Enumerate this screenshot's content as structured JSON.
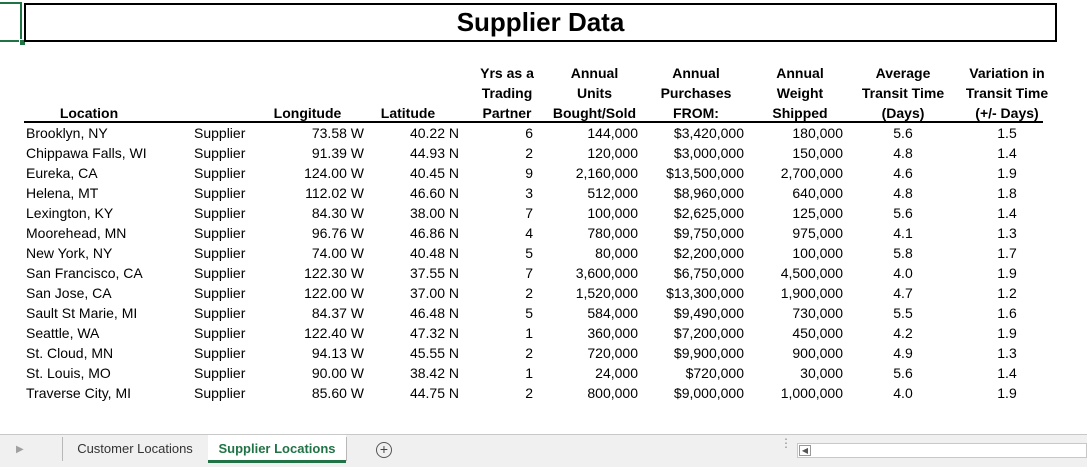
{
  "sheet": {
    "title": "Supplier Data",
    "headers": {
      "location": [
        "Location"
      ],
      "longitude": [
        "Longitude"
      ],
      "latitude": [
        "Latitude"
      ],
      "yrs": [
        "Yrs as a",
        "Trading",
        "Partner"
      ],
      "units": [
        "Annual",
        "Units",
        "Bought/Sold"
      ],
      "purchases": [
        "Annual",
        "Purchases",
        "FROM:"
      ],
      "weight": [
        "Annual",
        "Weight",
        "Shipped"
      ],
      "transit": [
        "Average",
        "Transit Time",
        "(Days)"
      ],
      "variation": [
        "Variation in",
        "Transit Time",
        "(+/- Days)"
      ]
    },
    "rows": [
      {
        "location": "Brooklyn, NY",
        "type": "Supplier",
        "longitude": "73.58 W",
        "latitude": "40.22 N",
        "yrs": "6",
        "units": "144,000",
        "purchases": "$3,420,000",
        "weight": "180,000",
        "transit": "5.6",
        "variation": "1.5"
      },
      {
        "location": "Chippawa Falls, WI",
        "type": "Supplier",
        "longitude": "91.39 W",
        "latitude": "44.93 N",
        "yrs": "2",
        "units": "120,000",
        "purchases": "$3,000,000",
        "weight": "150,000",
        "transit": "4.8",
        "variation": "1.4"
      },
      {
        "location": "Eureka, CA",
        "type": "Supplier",
        "longitude": "124.00 W",
        "latitude": "40.45 N",
        "yrs": "9",
        "units": "2,160,000",
        "purchases": "$13,500,000",
        "weight": "2,700,000",
        "transit": "4.6",
        "variation": "1.9"
      },
      {
        "location": "Helena, MT",
        "type": "Supplier",
        "longitude": "112.02 W",
        "latitude": "46.60 N",
        "yrs": "3",
        "units": "512,000",
        "purchases": "$8,960,000",
        "weight": "640,000",
        "transit": "4.8",
        "variation": "1.8"
      },
      {
        "location": "Lexington, KY",
        "type": "Supplier",
        "longitude": "84.30 W",
        "latitude": "38.00 N",
        "yrs": "7",
        "units": "100,000",
        "purchases": "$2,625,000",
        "weight": "125,000",
        "transit": "5.6",
        "variation": "1.4"
      },
      {
        "location": "Moorehead, MN",
        "type": "Supplier",
        "longitude": "96.76 W",
        "latitude": "46.86 N",
        "yrs": "4",
        "units": "780,000",
        "purchases": "$9,750,000",
        "weight": "975,000",
        "transit": "4.1",
        "variation": "1.3"
      },
      {
        "location": "New York, NY",
        "type": "Supplier",
        "longitude": "74.00 W",
        "latitude": "40.48 N",
        "yrs": "5",
        "units": "80,000",
        "purchases": "$2,200,000",
        "weight": "100,000",
        "transit": "5.8",
        "variation": "1.7"
      },
      {
        "location": "San Francisco, CA",
        "type": "Supplier",
        "longitude": "122.30 W",
        "latitude": "37.55 N",
        "yrs": "7",
        "units": "3,600,000",
        "purchases": "$6,750,000",
        "weight": "4,500,000",
        "transit": "4.0",
        "variation": "1.9"
      },
      {
        "location": "San Jose, CA",
        "type": "Supplier",
        "longitude": "122.00 W",
        "latitude": "37.00 N",
        "yrs": "2",
        "units": "1,520,000",
        "purchases": "$13,300,000",
        "weight": "1,900,000",
        "transit": "4.7",
        "variation": "1.2"
      },
      {
        "location": "Sault St Marie, MI",
        "type": "Supplier",
        "longitude": "84.37 W",
        "latitude": "46.48 N",
        "yrs": "5",
        "units": "584,000",
        "purchases": "$9,490,000",
        "weight": "730,000",
        "transit": "5.5",
        "variation": "1.6"
      },
      {
        "location": "Seattle, WA",
        "type": "Supplier",
        "longitude": "122.40 W",
        "latitude": "47.32 N",
        "yrs": "1",
        "units": "360,000",
        "purchases": "$7,200,000",
        "weight": "450,000",
        "transit": "4.2",
        "variation": "1.9"
      },
      {
        "location": "St. Cloud, MN",
        "type": "Supplier",
        "longitude": "94.13 W",
        "latitude": "45.55 N",
        "yrs": "2",
        "units": "720,000",
        "purchases": "$9,900,000",
        "weight": "900,000",
        "transit": "4.9",
        "variation": "1.3"
      },
      {
        "location": "St. Louis, MO",
        "type": "Supplier",
        "longitude": "90.00 W",
        "latitude": "38.42 N",
        "yrs": "1",
        "units": "24,000",
        "purchases": "$720,000",
        "weight": "30,000",
        "transit": "5.6",
        "variation": "1.4"
      },
      {
        "location": "Traverse City, MI",
        "type": "Supplier",
        "longitude": "85.60 W",
        "latitude": "44.75 N",
        "yrs": "2",
        "units": "800,000",
        "purchases": "$9,000,000",
        "weight": "1,000,000",
        "transit": "4.0",
        "variation": "1.9"
      }
    ]
  },
  "tabs": {
    "items": [
      {
        "label": "Customer Locations",
        "active": false
      },
      {
        "label": "Supplier Locations",
        "active": true
      }
    ],
    "add_icon": "plus-circle-icon",
    "accent": "#217346"
  }
}
